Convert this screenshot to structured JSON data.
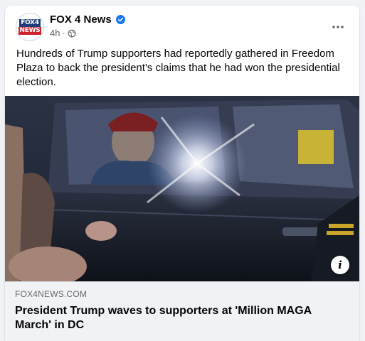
{
  "post": {
    "page_name": "FOX 4 News",
    "verified_icon": "verified-badge-icon",
    "time_ago": "4h",
    "separator": "·",
    "audience_icon": "globe-icon",
    "avatar_logo_top": "FOX4",
    "avatar_logo_bottom": "NEWS",
    "text": "Hundreds of Trump supporters had reportedly gathered in Freedom Plaza to back the president's claims that he had won the presidential election.",
    "more_icon": "more-options-icon"
  },
  "media": {
    "info_label": "i"
  },
  "link_preview": {
    "domain": "FOX4NEWS.COM",
    "title": "President Trump waves to supporters at 'Million MAGA March' in DC"
  },
  "colors": {
    "brand_blue": "#1877f2",
    "fox_navy": "#1e3c78",
    "fox_red": "#d0202c",
    "secondary_text": "#65676b"
  }
}
